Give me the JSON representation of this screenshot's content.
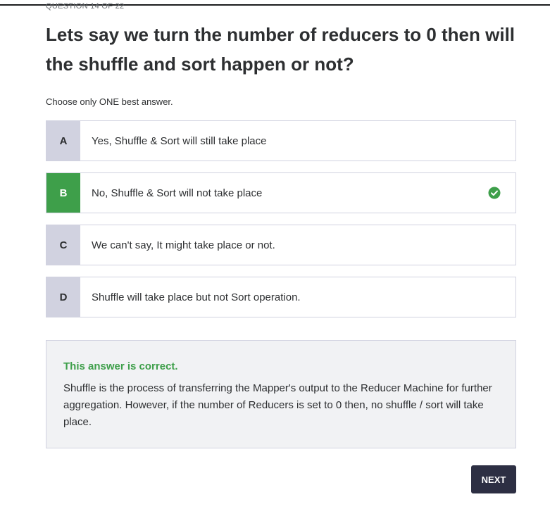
{
  "header": {
    "counter": "QUESTION 14 OF 22",
    "question": "Lets say we turn the number of reducers to 0 then will the shuffle and sort happen or not?",
    "instruction": "Choose only ONE best answer."
  },
  "options": [
    {
      "letter": "A",
      "text": "Yes, Shuffle & Sort will still take place",
      "selected": false
    },
    {
      "letter": "B",
      "text": "No, Shuffle & Sort will not take place",
      "selected": true,
      "correct": true
    },
    {
      "letter": "C",
      "text": "We can't say, It might take place or not.",
      "selected": false
    },
    {
      "letter": "D",
      "text": "Shuffle will take place but not Sort operation.",
      "selected": false
    }
  ],
  "feedback": {
    "status": "This answer is correct.",
    "explanation": "Shuffle is the process of transferring the Mapper's output to the Reducer Machine for further aggregation. However, if the number of Reducers is set to 0 then, no shuffle / sort will take place."
  },
  "actions": {
    "next_label": "NEXT"
  },
  "colors": {
    "correct": "#3e9f4a",
    "letter_bg": "#d1d2e0",
    "button_bg": "#2d2f43"
  },
  "icons": {
    "correct": "check-circle-icon"
  }
}
